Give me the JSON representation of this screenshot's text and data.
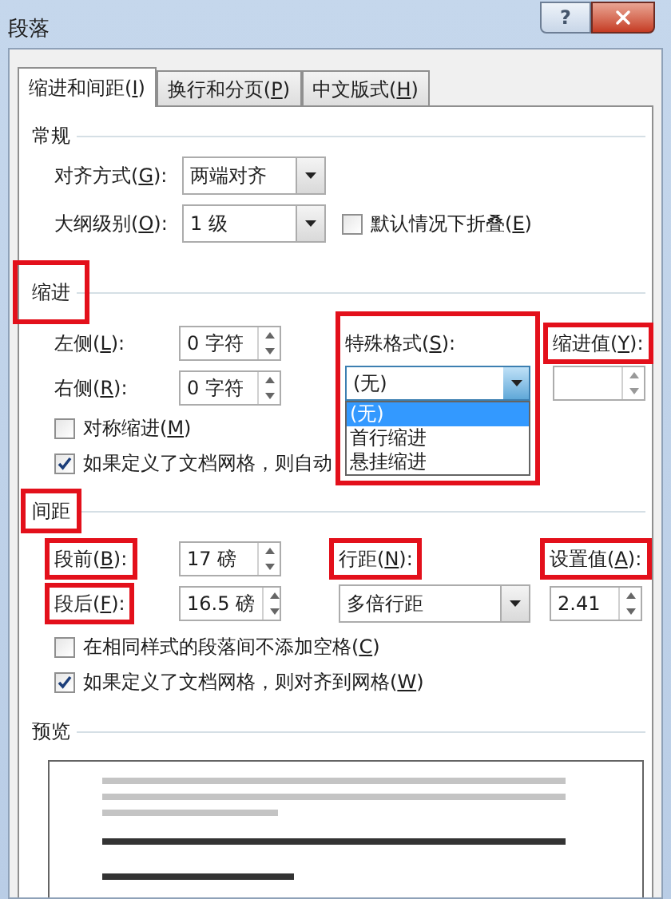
{
  "window": {
    "title": "段落",
    "help": "?"
  },
  "tabs": [
    {
      "label": "缩进和间距(I)",
      "selected": true
    },
    {
      "label": "换行和分页(P)",
      "selected": false
    },
    {
      "label": "中文版式(H)",
      "selected": false
    }
  ],
  "general": {
    "heading": "常规",
    "alignment": {
      "label": "对齐方式(G):",
      "value": "两端对齐"
    },
    "outline_level": {
      "label": "大纲级别(O):",
      "value": "1 级"
    },
    "collapse": {
      "label": "默认情况下折叠(E)",
      "checked": false
    }
  },
  "indent": {
    "heading": "缩进",
    "highlighted": true,
    "left": {
      "label": "左侧(L):",
      "value": "0 字符"
    },
    "right": {
      "label": "右侧(R):",
      "value": "0 字符"
    },
    "special": {
      "label": "特殊格式(S):",
      "value": "(无)",
      "highlighted": true,
      "expanded": true,
      "options": [
        {
          "label": "(无)",
          "selected": true
        },
        {
          "label": "首行缩进",
          "selected": false
        },
        {
          "label": "悬挂缩进",
          "selected": false
        }
      ]
    },
    "by": {
      "label": "缩进值(Y):",
      "highlighted": true
    },
    "mirror": {
      "label": "对称缩进(M)",
      "checked": false
    },
    "grid": {
      "label": "如果定义了文档网格，则自动",
      "checked": true
    }
  },
  "spacing": {
    "heading": "间距",
    "highlighted": true,
    "before": {
      "label": "段前(B):",
      "value": "17 磅",
      "highlighted": true
    },
    "after": {
      "label": "段后(F):",
      "value": "16.5 磅",
      "highlighted": true
    },
    "line_spacing": {
      "label": "行距(N):",
      "value": "多倍行距",
      "highlighted": true
    },
    "at": {
      "label": "设置值(A):",
      "value": "2.41",
      "highlighted": true
    },
    "no_space": {
      "label": "在相同样式的段落间不添加空格(C)",
      "checked": false
    },
    "snap": {
      "label": "如果定义了文档网格，则对齐到网格(W)",
      "checked": true
    }
  },
  "preview": {
    "heading": "预览"
  }
}
